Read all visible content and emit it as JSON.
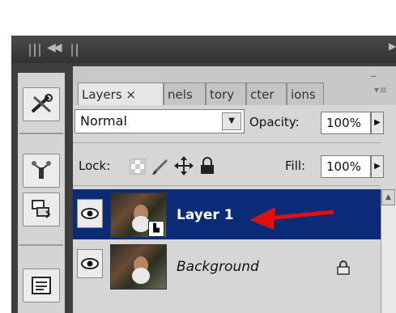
{
  "tabs": [
    {
      "label": "Layers ×",
      "active": true
    },
    {
      "label": "nels",
      "active": false
    },
    {
      "label": "tory",
      "active": false
    },
    {
      "label": "cter",
      "active": false
    },
    {
      "label": "ions",
      "active": false
    }
  ],
  "blend_mode": {
    "value": "Normal"
  },
  "opacity": {
    "label": "Opacity:",
    "value": "100%"
  },
  "lock": {
    "label": "Lock:"
  },
  "fill": {
    "label": "Fill:",
    "value": "100%"
  },
  "layers": [
    {
      "name": "Layer 1",
      "selected": true
    },
    {
      "name": "Background",
      "selected": false,
      "locked": true
    }
  ],
  "colors": {
    "selection": "#0b2a78",
    "annotation_arrow": "#e01010",
    "panel_bg": "#d6d6d6",
    "frame_bg": "#3e3e3e"
  },
  "icons": {
    "tools": [
      "tools-icon",
      "puppet-icon",
      "stamp-icon",
      "document-icon"
    ],
    "lock": [
      "lock-transparent-icon",
      "lock-brush-icon",
      "lock-move-icon",
      "lock-all-icon"
    ]
  }
}
